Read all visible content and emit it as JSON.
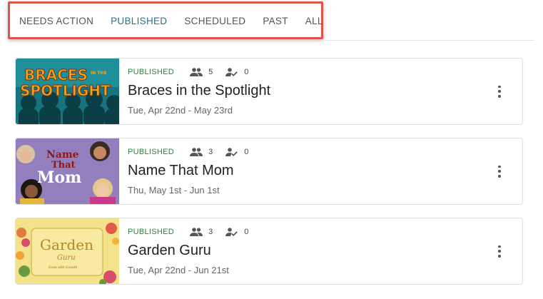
{
  "tabs": [
    {
      "label": "NEEDS ACTION",
      "active": false
    },
    {
      "label": "PUBLISHED",
      "active": true
    },
    {
      "label": "SCHEDULED",
      "active": false
    },
    {
      "label": "PAST",
      "active": false
    },
    {
      "label": "ALL",
      "active": false
    }
  ],
  "events": [
    {
      "status": "PUBLISHED",
      "participants": "5",
      "completed": "0",
      "title": "Braces in the Spotlight",
      "dates": "Tue, Apr 22nd - May 23rd",
      "thumb_text": {
        "line1": "BRACES",
        "small": "IN THE",
        "line2": "SPOTLIGHT"
      }
    },
    {
      "status": "PUBLISHED",
      "participants": "3",
      "completed": "0",
      "title": "Name That Mom",
      "dates": "Thu, May 1st - Jun 1st",
      "thumb_text": {
        "line1": "Name",
        "line2": "That",
        "line3": "Mom"
      }
    },
    {
      "status": "PUBLISHED",
      "participants": "3",
      "completed": "0",
      "title": "Garden Guru",
      "dates": "Tue, Apr 22nd - Jun 21st",
      "thumb_text": {
        "line1": "Garden",
        "line2": "Guru",
        "small": "Grow with Growth"
      }
    }
  ],
  "colors": {
    "active_tab": "#2a6f8f",
    "status": "#2e7d32",
    "highlight_border": "#e0544f"
  },
  "icons": {
    "participants": "people-icon",
    "completed": "person-check-icon",
    "menu": "more-vertical-icon"
  }
}
